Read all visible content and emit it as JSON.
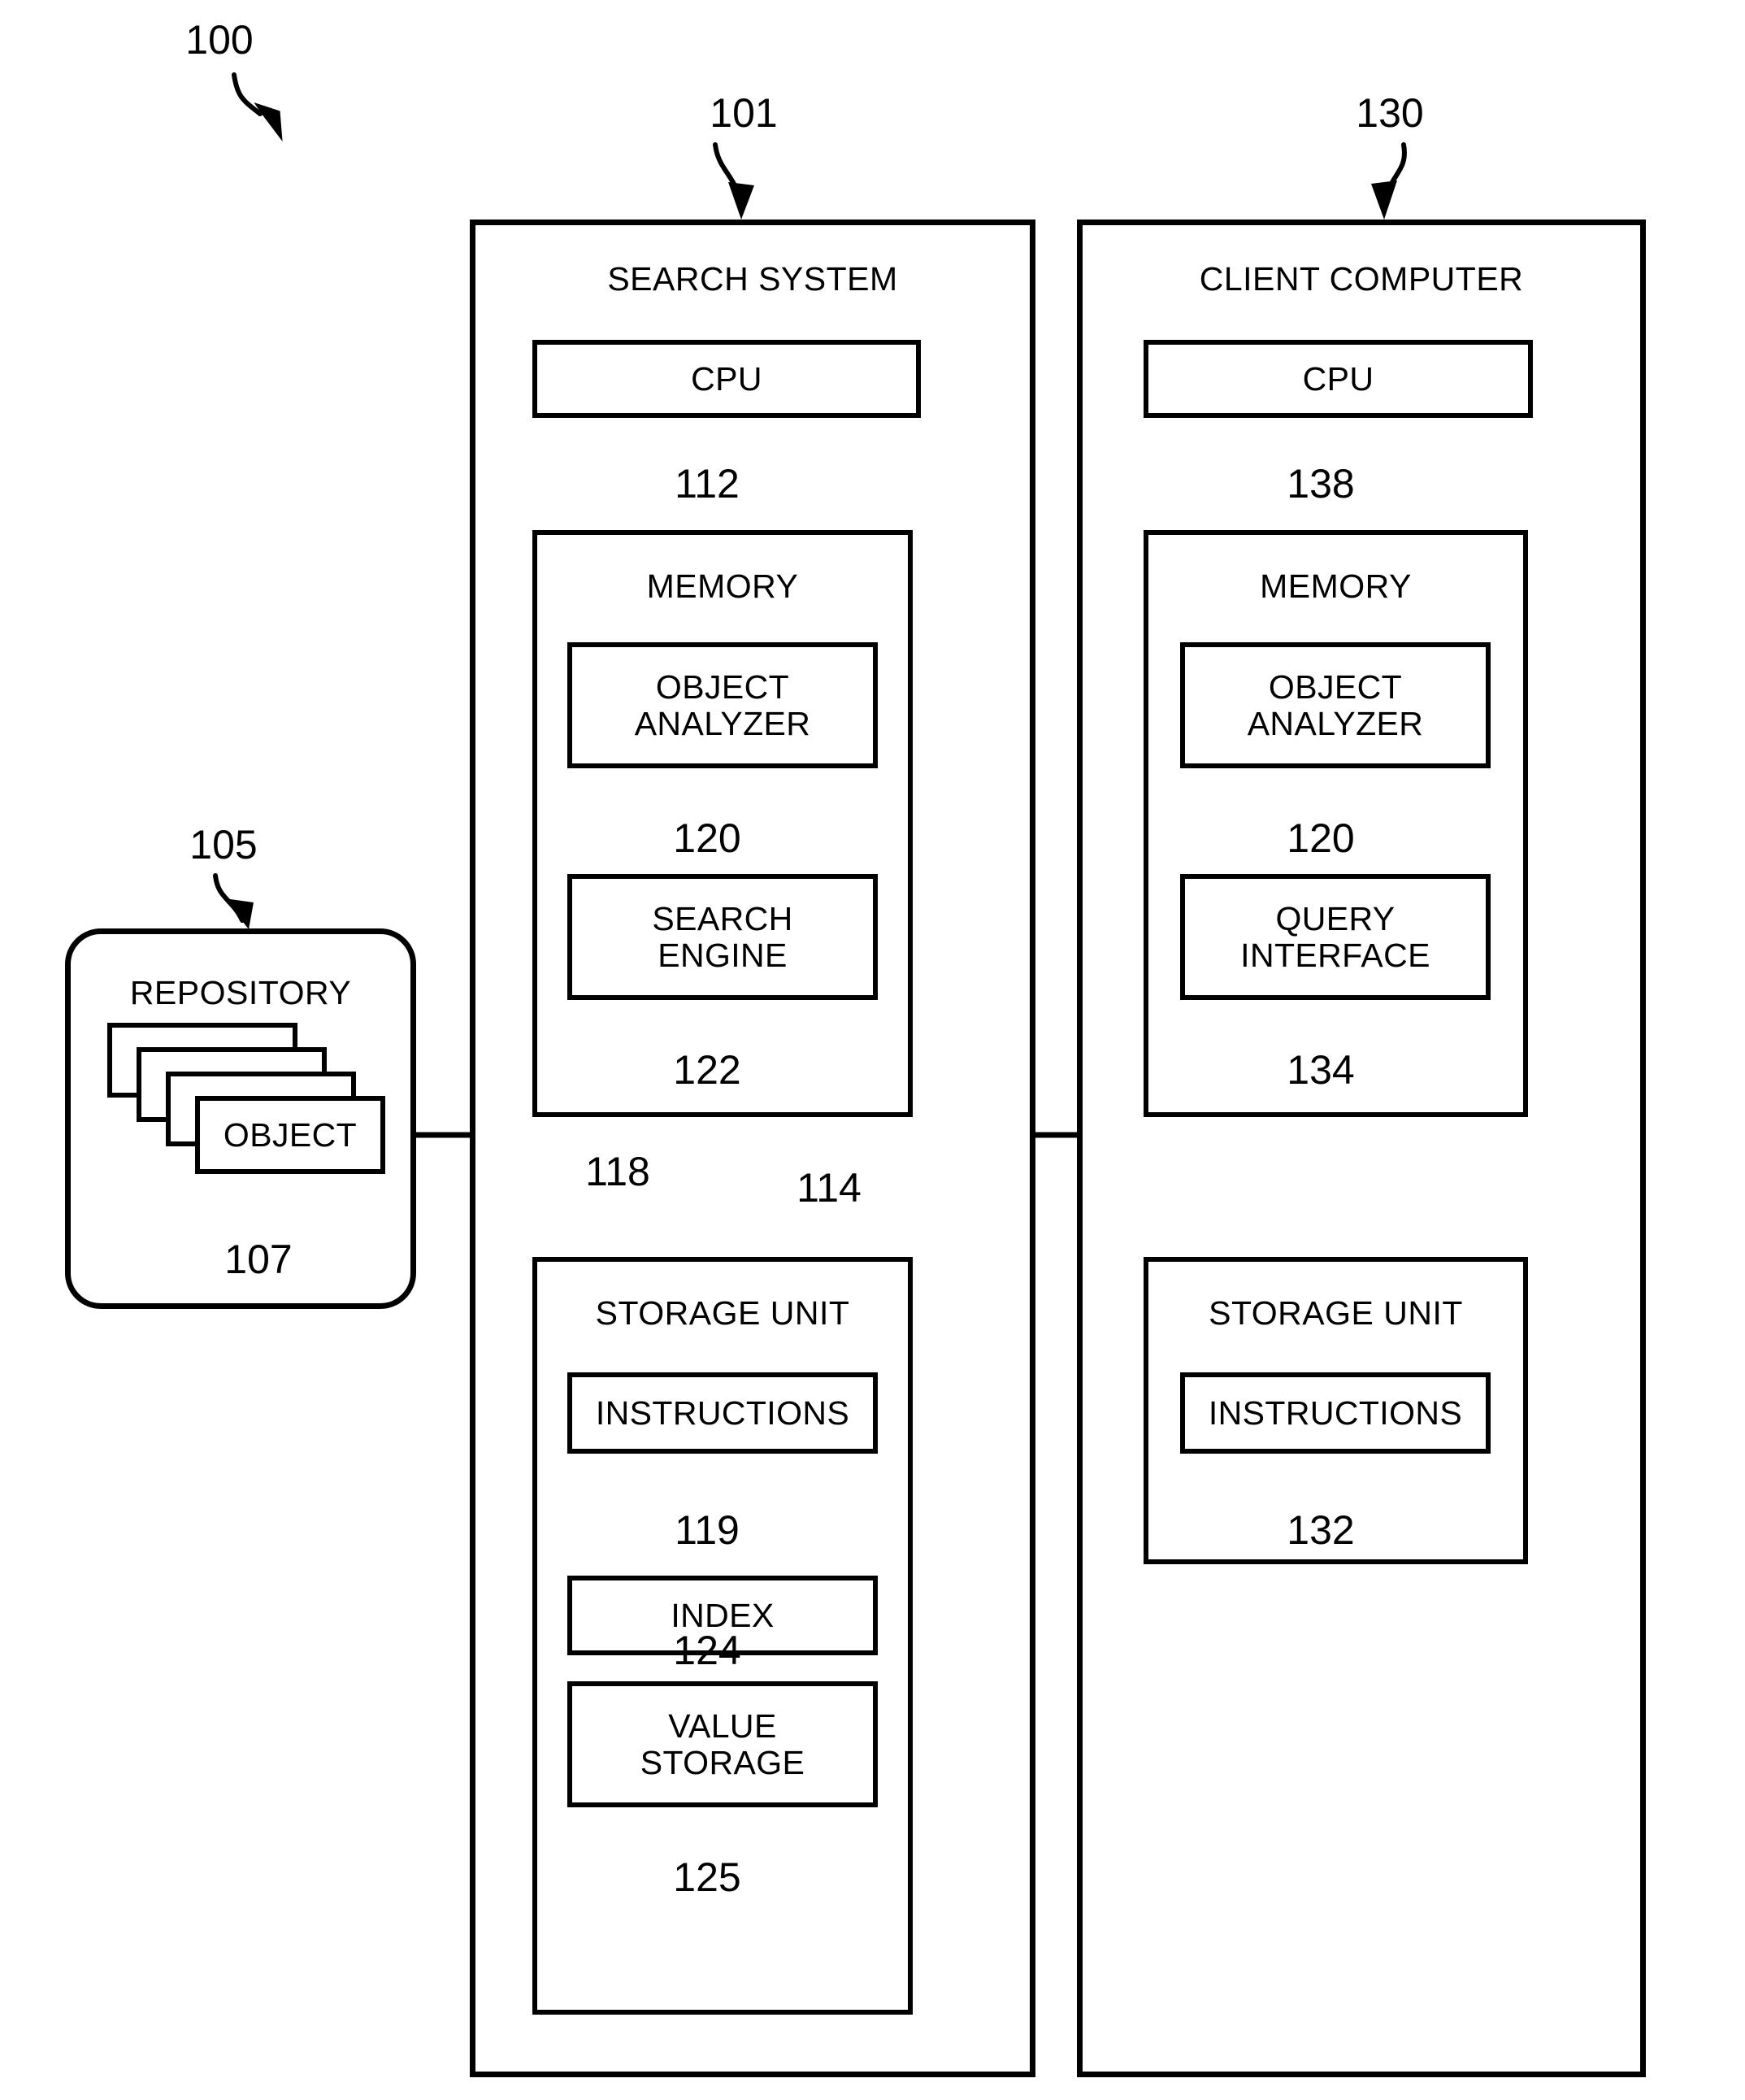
{
  "figure": {
    "ref_main": "100"
  },
  "search_system": {
    "ref": "101",
    "title": "SEARCH SYSTEM",
    "cpu": {
      "label": "CPU",
      "ref": "112"
    },
    "memory": {
      "title": "MEMORY",
      "ref": "114",
      "modules": [
        {
          "label": "OBJECT\nANALYZER",
          "line1": "OBJECT",
          "line2": "ANALYZER",
          "ref": "120"
        },
        {
          "label": "SEARCH\nENGINE",
          "line1": "SEARCH",
          "line2": "ENGINE",
          "ref": "122"
        }
      ]
    },
    "storage_unit": {
      "title": "STORAGE UNIT",
      "ref": "118",
      "modules": [
        {
          "line1": "INSTRUCTIONS",
          "line2": "",
          "ref": "119"
        },
        {
          "line1": "INDEX",
          "line2": "",
          "ref": "124"
        },
        {
          "line1": "VALUE",
          "line2": "STORAGE",
          "ref": "125"
        }
      ]
    }
  },
  "client_computer": {
    "ref": "130",
    "title": "CLIENT COMPUTER",
    "cpu": {
      "label": "CPU",
      "ref": "138"
    },
    "memory": {
      "title": "MEMORY",
      "modules": [
        {
          "line1": "OBJECT",
          "line2": "ANALYZER",
          "ref": "120"
        },
        {
          "line1": "QUERY",
          "line2": "INTERFACE",
          "ref": "134"
        }
      ]
    },
    "storage_unit": {
      "title": "STORAGE UNIT",
      "modules": [
        {
          "line1": "INSTRUCTIONS",
          "line2": "",
          "ref": "132"
        }
      ]
    }
  },
  "repository": {
    "ref": "105",
    "title": "REPOSITORY",
    "object": {
      "label": "OBJECT",
      "ref": "107"
    }
  }
}
